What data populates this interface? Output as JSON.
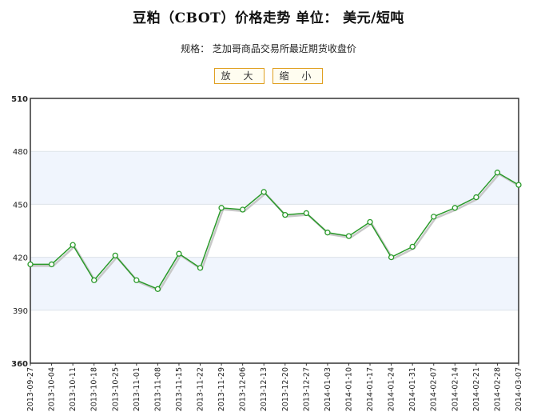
{
  "header": {
    "title": "豆粕（CBOT）价格走势   单位：  美元/短吨",
    "subtitle": "规格：  芝加哥商品交易所最近期货收盘价"
  },
  "controls": {
    "zoom_in_label": "放 大",
    "zoom_out_label": "缩 小"
  },
  "colors": {
    "line": "#2a9a2a",
    "shadow": "#c8c8c8",
    "band": "#f0f5fd",
    "marker_fill": "#ffffff"
  },
  "chart_data": {
    "type": "line",
    "title": "豆粕（CBOT）价格走势   单位：  美元/短吨",
    "subtitle": "规格：  芝加哥商品交易所最近期货收盘价",
    "xlabel": "",
    "ylabel": "",
    "ylim": [
      360,
      510
    ],
    "yticks": [
      360,
      390,
      420,
      450,
      480,
      510
    ],
    "grid": true,
    "x": [
      "2013-09-27",
      "2013-10-04",
      "2013-10-11",
      "2013-10-18",
      "2013-10-25",
      "2013-11-01",
      "2013-11-08",
      "2013-11-15",
      "2013-11-22",
      "2013-11-29",
      "2013-12-06",
      "2013-12-13",
      "2013-12-20",
      "2013-12-27",
      "2014-01-03",
      "2014-01-10",
      "2014-01-17",
      "2014-01-24",
      "2014-01-31",
      "2014-02-07",
      "2014-02-14",
      "2014-02-21",
      "2014-02-28",
      "2014-03-07"
    ],
    "series": [
      {
        "values": [
          416,
          416,
          427,
          407,
          421,
          407,
          402,
          422,
          414,
          448,
          447,
          457,
          444,
          445,
          434,
          432,
          440,
          420,
          426,
          443,
          448,
          454,
          468,
          461
        ]
      }
    ]
  }
}
